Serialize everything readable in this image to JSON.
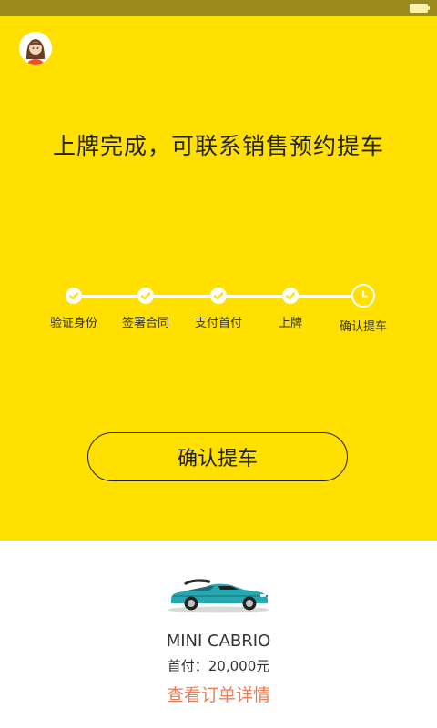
{
  "hero": {
    "title": "上牌完成，可联系销售预约提车",
    "confirm_label": "确认提车"
  },
  "steps": [
    {
      "label": "验证身份",
      "state": "done"
    },
    {
      "label": "签署合同",
      "state": "done"
    },
    {
      "label": "支付首付",
      "state": "done"
    },
    {
      "label": "上牌",
      "state": "done"
    },
    {
      "label": "确认提车",
      "state": "current"
    }
  ],
  "car": {
    "name": "MINI CABRIO",
    "price": "首付：20,000元",
    "details_link": "查看订单详情"
  },
  "colors": {
    "brand_yellow": "#ffe000",
    "link_orange": "#f37b52"
  }
}
